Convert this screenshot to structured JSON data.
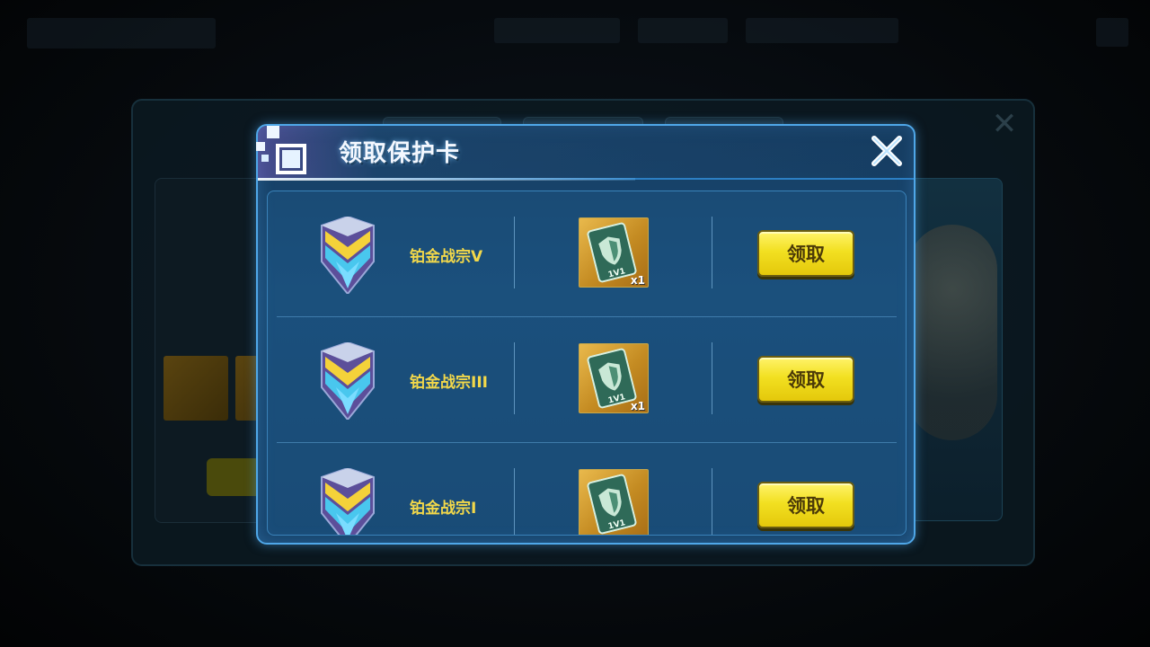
{
  "dialog": {
    "title": "领取保护卡",
    "close_icon": "close-icon"
  },
  "rewards": [
    {
      "rank": "铂金战宗V",
      "item_icon": "protection-card-icon",
      "item_count": "x1",
      "claim_label": "领取"
    },
    {
      "rank": "铂金战宗III",
      "item_icon": "protection-card-icon",
      "item_count": "x1",
      "claim_label": "领取"
    },
    {
      "rank": "铂金战宗I",
      "item_icon": "protection-card-icon",
      "item_count": "",
      "claim_label": "领取"
    }
  ],
  "colors": {
    "dialog_border": "#4fa7e8",
    "rank_text": "#f2d84a",
    "claim_button": "#f2e021"
  }
}
